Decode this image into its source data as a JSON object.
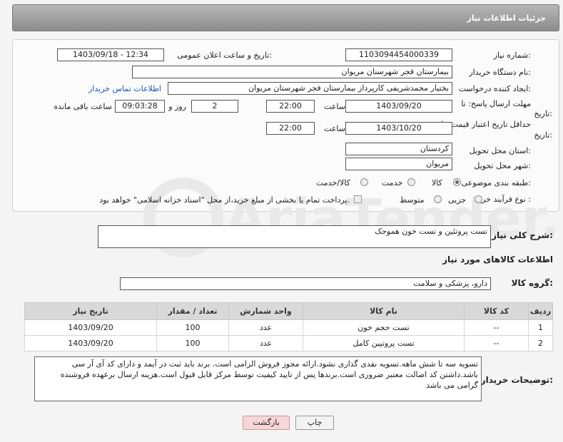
{
  "header": {
    "title": "جزئیات اطلاعات نیاز"
  },
  "form": {
    "need_number_label": "شماره نیاز:",
    "need_number": "1103094454000339",
    "announce_label": "تاریخ و ساعت اعلان عمومی:",
    "announce_value": "1403/09/18 - 12:34",
    "buyer_org_label": "نام دستگاه خریدار:",
    "buyer_org": "بیمارستان فجر شهرستان مریوان",
    "creator_label": "ایجاد کننده درخواست:",
    "creator": "بختیار محمدشریفی کارپرداز بیمارستان فجر شهرستان مریوان",
    "contact_link": "اطلاعات تماس خریدار",
    "deadline_label_1": "مهلت ارسال پاسخ: تا",
    "deadline_label_2": "تاریخ:",
    "deadline_date": "1403/09/20",
    "time_label": "ساعت",
    "deadline_time": "22:00",
    "days": "2",
    "day_label": "روز و",
    "remaining_time": "09:03:28",
    "remaining_label": "ساعت باقی مانده",
    "validity_label_1": "حداقل تاریخ اعتبار قیمت: تا",
    "validity_label_2": "تاریخ:",
    "validity_date": "1403/10/20",
    "validity_time": "22:00",
    "province_label": "استان محل تحویل:",
    "province": "کردستان",
    "city_label": "شهر محل تحویل:",
    "city": "مریوان",
    "category_label": "طبقه بندی موضوعی:",
    "category_options": [
      "کالا",
      "خدمت",
      "کالا/خدمت"
    ],
    "purchase_type_label": "نوع فرآیند خرید :",
    "purchase_options": [
      "جزیی",
      "متوسط"
    ],
    "payment_note": "پرداخت تمام یا بخشی از مبلغ خرید،از محل \"اسناد خزانه اسلامی\" خواهد بود."
  },
  "summary": {
    "label": "شرح کلی نیاز:",
    "value": "تست پروتئین و تست خون هموجک"
  },
  "goods": {
    "section_title": "اطلاعات کالاهای مورد نیاز",
    "group_label": "گروه کالا:",
    "group_value": "دارو، پزشکی و سلامت",
    "columns": [
      "ردیف",
      "کد کالا",
      "نام کالا",
      "واحد شمارش",
      "تعداد / مقدار",
      "تاریخ نیاز"
    ],
    "rows": [
      [
        "1",
        "--",
        "تست حجم خون",
        "عدد",
        "100",
        "1403/09/20"
      ],
      [
        "2",
        "--",
        "تست پروتیین کامل",
        "عدد",
        "100",
        "1403/09/20"
      ]
    ]
  },
  "buyer_notes": {
    "label": "توضیحات خریدار:",
    "text": "تسویه سه تا شش ماهه.تسویه نقدی گذاری نشود.ارائه مجوز فروش الزامی است. برند باید ثبت در آیمد و دارای کد آی آر سی باشد.داشتن کد اصالت معتبر ضروری است.برندها پس از تایید کیفیت توسط مرکز قابل قبول است.هزینه ارسال برعهده فروشنده گرامی می باشد"
  },
  "buttons": {
    "print": "چاپ",
    "back": "بازگشت"
  },
  "watermark": "AriaTender.neT",
  "colors": {
    "header_bg": "#9a9a9a",
    "link": "#1a55c4",
    "back_btn_bg": "#f6d6d6"
  }
}
